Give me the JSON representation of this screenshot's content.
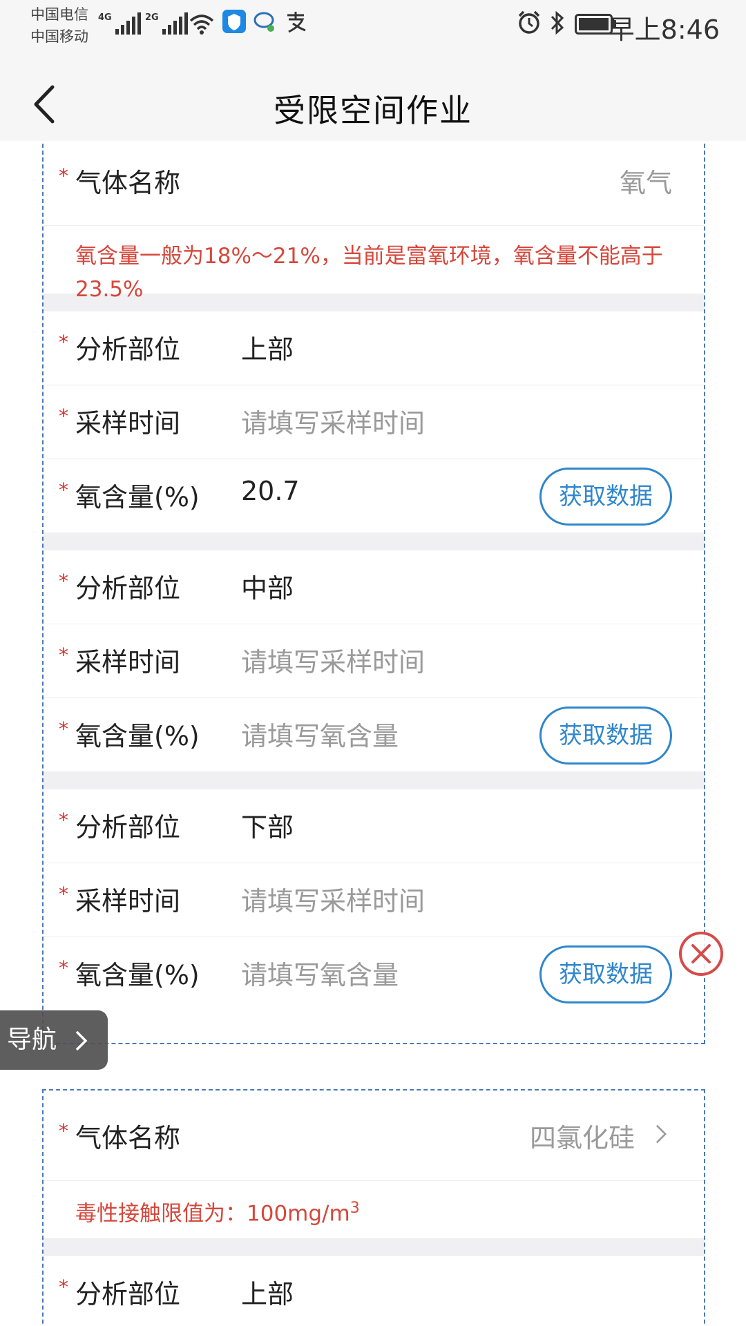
{
  "status_bar": {
    "carrier1": "中国电信",
    "carrier2": "中国移动",
    "net1": "4G",
    "net2": "2G",
    "time": "早上8:46",
    "icons": [
      "signal-icon",
      "wifi-icon",
      "shield-app-icon",
      "chat-app-icon",
      "alipay-icon",
      "alarm-icon",
      "bluetooth-icon",
      "battery-icon"
    ]
  },
  "header": {
    "title": "受限空间作业",
    "back_icon": "chevron-left-icon"
  },
  "card1": {
    "gas_label": "气体名称",
    "gas_value": "氧气",
    "warning": "氧含量一般为18%～21%，当前是富氧环境，氧含量不能高于23.5%",
    "groups": [
      {
        "position_label": "分析部位",
        "position_value": "上部",
        "time_label": "采样时间",
        "time_placeholder": "请填写采样时间",
        "oxygen_label": "氧含量(%)",
        "oxygen_value": "20.7",
        "oxygen_placeholder": "请填写氧含量",
        "fetch_label": "获取数据"
      },
      {
        "position_label": "分析部位",
        "position_value": "中部",
        "time_label": "采样时间",
        "time_placeholder": "请填写采样时间",
        "oxygen_label": "氧含量(%)",
        "oxygen_value": "",
        "oxygen_placeholder": "请填写氧含量",
        "fetch_label": "获取数据"
      },
      {
        "position_label": "分析部位",
        "position_value": "下部",
        "time_label": "采样时间",
        "time_placeholder": "请填写采样时间",
        "oxygen_label": "氧含量(%)",
        "oxygen_value": "",
        "oxygen_placeholder": "请填写氧含量",
        "fetch_label": "获取数据"
      }
    ]
  },
  "card2": {
    "gas_label": "气体名称",
    "gas_value": "四氯化硅",
    "limit_prefix": "毒性接触限值为：100mg/m",
    "limit_sup": "3",
    "position_label": "分析部位",
    "position_value": "上部"
  },
  "floating_nav": {
    "label": "导航"
  },
  "colors": {
    "required": "#d9302b",
    "warning_text": "#d5473b",
    "button": "#2f86cc",
    "dashed_border": "#4a78b8",
    "close": "#d64b4b"
  }
}
